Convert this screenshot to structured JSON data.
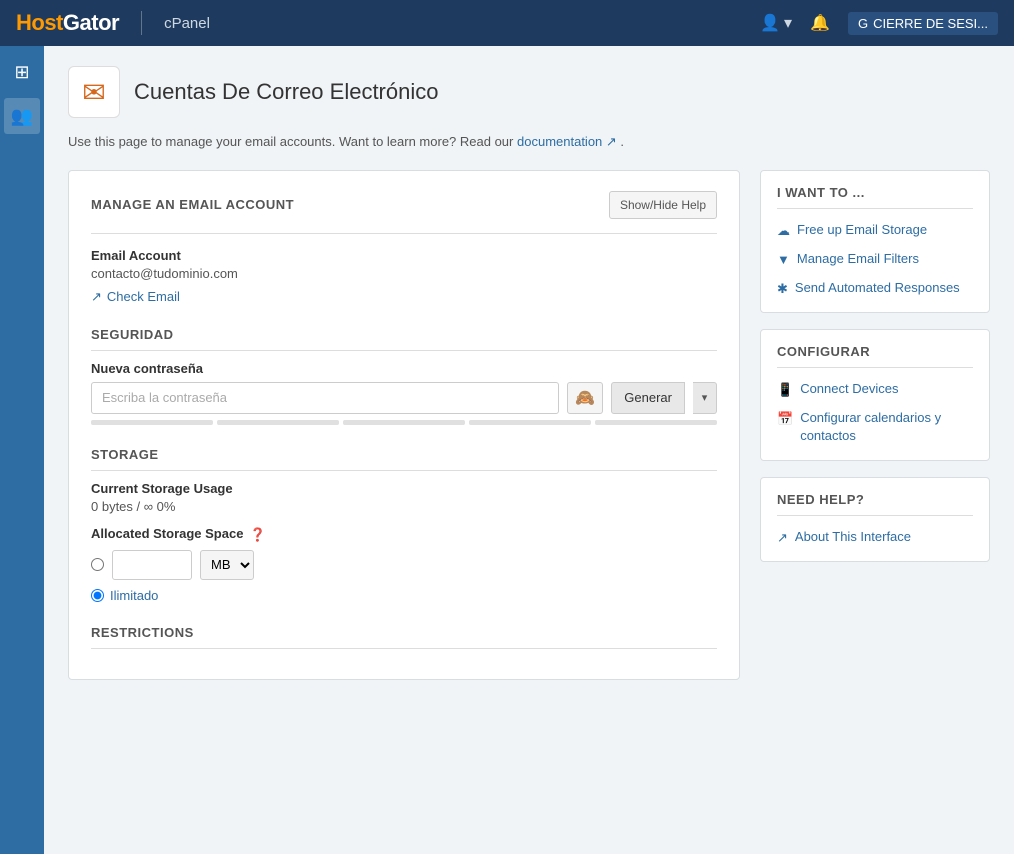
{
  "topnav": {
    "brand": "HostGator",
    "brand_orange": "Host",
    "cpanel": "cPanel",
    "user_icon": "👤",
    "bell_icon": "🔔",
    "logout_label": "CIERRE DE SESI..."
  },
  "sidebar": {
    "items": [
      {
        "icon": "⊞",
        "label": "grid-icon"
      },
      {
        "icon": "👥",
        "label": "users-icon"
      }
    ]
  },
  "page": {
    "icon": "✉",
    "title": "Cuentas De Correo Electrónico",
    "description_start": "Use this page to manage your email accounts. Want to learn more? Read our",
    "documentation_link": "documentation",
    "description_end": "."
  },
  "manage_section": {
    "title": "MANAGE AN EMAIL ACCOUNT",
    "show_hide_btn": "Show/Hide Help",
    "email_label": "Email Account",
    "email_value": "contacto@tudominio.com",
    "check_email_link": "Check Email"
  },
  "security_section": {
    "title": "SEGURIDAD",
    "password_label": "Nueva contraseña",
    "password_placeholder": "Escriba la contraseña",
    "generate_btn": "Generar"
  },
  "storage_section": {
    "title": "STORAGE",
    "current_label": "Current Storage Usage",
    "current_value": "0 bytes / ∞ 0%",
    "alloc_label": "Allocated Storage Space",
    "alloc_placeholder": "",
    "mb_option": "MB",
    "unlimited_label": "Ilimitado"
  },
  "restrictions_section": {
    "title": "RESTRICTIONS"
  },
  "i_want_to": {
    "title": "I WANT TO ...",
    "links": [
      {
        "icon": "☁",
        "label": "Free up Email Storage"
      },
      {
        "icon": "▼",
        "label": "Manage Email Filters"
      },
      {
        "icon": "✱",
        "label": "Send Automated Responses"
      }
    ]
  },
  "configurar": {
    "title": "CONFIGURAR",
    "links": [
      {
        "icon": "📱",
        "label": "Connect Devices"
      },
      {
        "icon": "📅",
        "label": "Configurar calendarios y contactos"
      }
    ]
  },
  "need_help": {
    "title": "NEED HELP?",
    "links": [
      {
        "icon": "↗",
        "label": "About This Interface"
      }
    ]
  }
}
